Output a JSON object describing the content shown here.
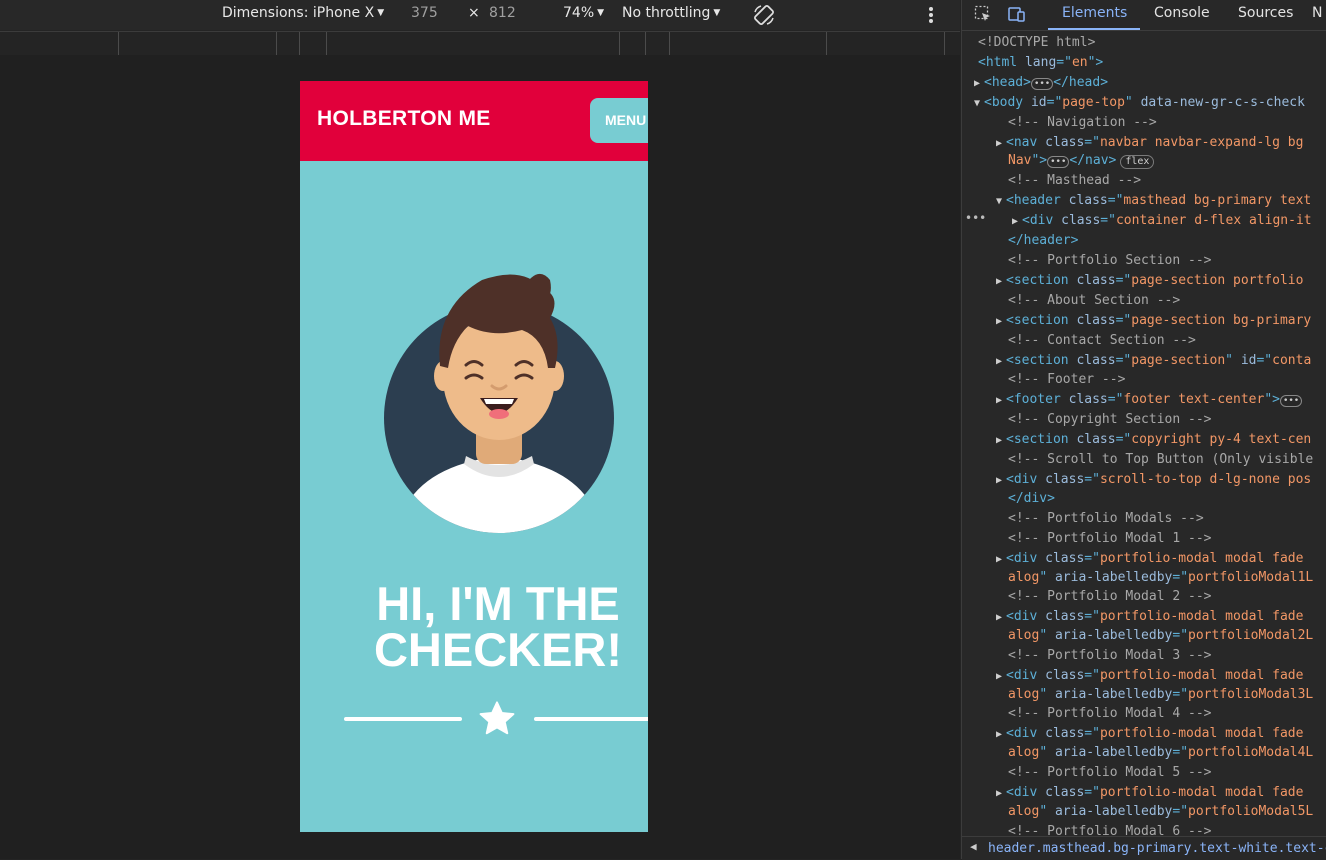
{
  "devbar": {
    "dimensions_label": "Dimensions: iPhone X",
    "width": "375",
    "times": "×",
    "height": "812",
    "zoom": "74%",
    "throttling": "No throttling"
  },
  "site": {
    "brand": "HOLBERTON ME",
    "menu": "MENU",
    "title_line1": "HI, I'M THE",
    "title_line2": "CHECKER!",
    "colors": {
      "navbar": "#e1003b",
      "primary": "#78ccd2",
      "avatar_bg": "#2c3e50"
    }
  },
  "devtools": {
    "tabs": [
      "Elements",
      "Console",
      "Sources",
      "N"
    ],
    "badge_flex": "flex",
    "lines": [
      [
        {
          "c": "cmt",
          "t": "<!DOCTYPE html>"
        }
      ],
      [
        {
          "c": "tag",
          "t": "<html "
        },
        {
          "c": "attr",
          "t": "lang"
        },
        {
          "c": "tag",
          "t": "=\""
        },
        {
          "c": "val",
          "t": "en"
        },
        {
          "c": "tag",
          "t": "\">"
        }
      ],
      [
        {
          "c": "tag",
          "t": "<head>"
        },
        {
          "c": "ell",
          "t": "•••"
        },
        {
          "c": "tag",
          "t": "</head>"
        }
      ],
      [
        {
          "c": "tag",
          "t": "<body "
        },
        {
          "c": "attr",
          "t": "id"
        },
        {
          "c": "tag",
          "t": "=\""
        },
        {
          "c": "val",
          "t": "page-top"
        },
        {
          "c": "tag",
          "t": "\" "
        },
        {
          "c": "attr",
          "t": "data-new-gr-c-s-check"
        }
      ],
      [
        {
          "c": "cmt",
          "t": "<!-- Navigation -->"
        }
      ],
      [
        {
          "c": "tag",
          "t": "<nav "
        },
        {
          "c": "attr",
          "t": "class"
        },
        {
          "c": "tag",
          "t": "=\""
        },
        {
          "c": "val",
          "t": "navbar navbar-expand-lg bg"
        }
      ],
      [
        {
          "c": "val",
          "t": "Nav"
        },
        {
          "c": "tag",
          "t": "\">"
        },
        {
          "c": "ell",
          "t": "•••"
        },
        {
          "c": "tag",
          "t": "</nav>"
        }
      ],
      [
        {
          "c": "cmt",
          "t": "<!-- Masthead -->"
        }
      ],
      [
        {
          "c": "tag",
          "t": "<header "
        },
        {
          "c": "attr",
          "t": "class"
        },
        {
          "c": "tag",
          "t": "=\""
        },
        {
          "c": "val",
          "t": "masthead bg-primary text"
        }
      ],
      [
        {
          "c": "tag",
          "t": "<div "
        },
        {
          "c": "attr",
          "t": "class"
        },
        {
          "c": "tag",
          "t": "=\""
        },
        {
          "c": "val",
          "t": "container d-flex align-it"
        }
      ],
      [
        {
          "c": "tag",
          "t": "</header>"
        }
      ],
      [
        {
          "c": "cmt",
          "t": "<!-- Portfolio Section -->"
        }
      ],
      [
        {
          "c": "tag",
          "t": "<section "
        },
        {
          "c": "attr",
          "t": "class"
        },
        {
          "c": "tag",
          "t": "=\""
        },
        {
          "c": "val",
          "t": "page-section portfolio"
        }
      ],
      [
        {
          "c": "cmt",
          "t": "<!-- About Section -->"
        }
      ],
      [
        {
          "c": "tag",
          "t": "<section "
        },
        {
          "c": "attr",
          "t": "class"
        },
        {
          "c": "tag",
          "t": "=\""
        },
        {
          "c": "val",
          "t": "page-section bg-primary"
        }
      ],
      [
        {
          "c": "cmt",
          "t": "<!-- Contact Section -->"
        }
      ],
      [
        {
          "c": "tag",
          "t": "<section "
        },
        {
          "c": "attr",
          "t": "class"
        },
        {
          "c": "tag",
          "t": "=\""
        },
        {
          "c": "val",
          "t": "page-section"
        },
        {
          "c": "tag",
          "t": "\" "
        },
        {
          "c": "attr",
          "t": "id"
        },
        {
          "c": "tag",
          "t": "=\""
        },
        {
          "c": "val",
          "t": "conta"
        }
      ],
      [
        {
          "c": "cmt",
          "t": "<!-- Footer -->"
        }
      ],
      [
        {
          "c": "tag",
          "t": "<footer "
        },
        {
          "c": "attr",
          "t": "class"
        },
        {
          "c": "tag",
          "t": "=\""
        },
        {
          "c": "val",
          "t": "footer text-center"
        },
        {
          "c": "tag",
          "t": "\">"
        },
        {
          "c": "ell",
          "t": "•••"
        }
      ],
      [
        {
          "c": "cmt",
          "t": "<!-- Copyright Section -->"
        }
      ],
      [
        {
          "c": "tag",
          "t": "<section "
        },
        {
          "c": "attr",
          "t": "class"
        },
        {
          "c": "tag",
          "t": "=\""
        },
        {
          "c": "val",
          "t": "copyright py-4 text-cen"
        }
      ],
      [
        {
          "c": "cmt",
          "t": "<!-- Scroll to Top Button (Only visible"
        }
      ],
      [
        {
          "c": "tag",
          "t": "<div "
        },
        {
          "c": "attr",
          "t": "class"
        },
        {
          "c": "tag",
          "t": "=\""
        },
        {
          "c": "val",
          "t": "scroll-to-top d-lg-none pos"
        }
      ],
      [
        {
          "c": "tag",
          "t": "</div>"
        }
      ],
      [
        {
          "c": "cmt",
          "t": "<!-- Portfolio Modals -->"
        }
      ],
      [
        {
          "c": "cmt",
          "t": "<!-- Portfolio Modal 1 -->"
        }
      ],
      [
        {
          "c": "tag",
          "t": "<div "
        },
        {
          "c": "attr",
          "t": "class"
        },
        {
          "c": "tag",
          "t": "=\""
        },
        {
          "c": "val",
          "t": "portfolio-modal modal fade"
        }
      ],
      [
        {
          "c": "val",
          "t": "alog"
        },
        {
          "c": "tag",
          "t": "\" "
        },
        {
          "c": "attr",
          "t": "aria-labelledby"
        },
        {
          "c": "tag",
          "t": "=\""
        },
        {
          "c": "val",
          "t": "portfolioModal1L"
        }
      ],
      [
        {
          "c": "cmt",
          "t": "<!-- Portfolio Modal 2 -->"
        }
      ],
      [
        {
          "c": "tag",
          "t": "<div "
        },
        {
          "c": "attr",
          "t": "class"
        },
        {
          "c": "tag",
          "t": "=\""
        },
        {
          "c": "val",
          "t": "portfolio-modal modal fade"
        }
      ],
      [
        {
          "c": "val",
          "t": "alog"
        },
        {
          "c": "tag",
          "t": "\" "
        },
        {
          "c": "attr",
          "t": "aria-labelledby"
        },
        {
          "c": "tag",
          "t": "=\""
        },
        {
          "c": "val",
          "t": "portfolioModal2L"
        }
      ],
      [
        {
          "c": "cmt",
          "t": "<!-- Portfolio Modal 3 -->"
        }
      ],
      [
        {
          "c": "tag",
          "t": "<div "
        },
        {
          "c": "attr",
          "t": "class"
        },
        {
          "c": "tag",
          "t": "=\""
        },
        {
          "c": "val",
          "t": "portfolio-modal modal fade"
        }
      ],
      [
        {
          "c": "val",
          "t": "alog"
        },
        {
          "c": "tag",
          "t": "\" "
        },
        {
          "c": "attr",
          "t": "aria-labelledby"
        },
        {
          "c": "tag",
          "t": "=\""
        },
        {
          "c": "val",
          "t": "portfolioModal3L"
        }
      ],
      [
        {
          "c": "cmt",
          "t": "<!-- Portfolio Modal 4 -->"
        }
      ],
      [
        {
          "c": "tag",
          "t": "<div "
        },
        {
          "c": "attr",
          "t": "class"
        },
        {
          "c": "tag",
          "t": "=\""
        },
        {
          "c": "val",
          "t": "portfolio-modal modal fade"
        }
      ],
      [
        {
          "c": "val",
          "t": "alog"
        },
        {
          "c": "tag",
          "t": "\" "
        },
        {
          "c": "attr",
          "t": "aria-labelledby"
        },
        {
          "c": "tag",
          "t": "=\""
        },
        {
          "c": "val",
          "t": "portfolioModal4L"
        }
      ],
      [
        {
          "c": "cmt",
          "t": "<!-- Portfolio Modal 5 -->"
        }
      ],
      [
        {
          "c": "tag",
          "t": "<div "
        },
        {
          "c": "attr",
          "t": "class"
        },
        {
          "c": "tag",
          "t": "=\""
        },
        {
          "c": "val",
          "t": "portfolio-modal modal fade"
        }
      ],
      [
        {
          "c": "val",
          "t": "alog"
        },
        {
          "c": "tag",
          "t": "\" "
        },
        {
          "c": "attr",
          "t": "aria-labelledby"
        },
        {
          "c": "tag",
          "t": "=\""
        },
        {
          "c": "val",
          "t": "portfolioModal5L"
        }
      ],
      [
        {
          "c": "cmt",
          "t": "<!-- Portfolio Modal 6 -->"
        }
      ]
    ],
    "breadcrumb": "header.masthead.bg-primary.text-white.text-center"
  }
}
